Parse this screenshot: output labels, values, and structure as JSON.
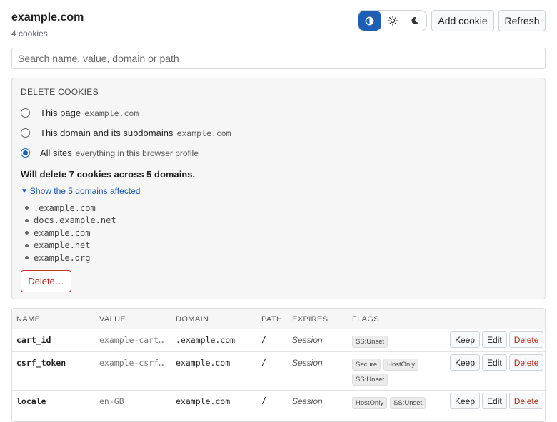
{
  "header": {
    "title": "example.com",
    "subtitle": "4 cookies",
    "theme_modes": [
      {
        "name": "auto-theme-icon",
        "active": true
      },
      {
        "name": "sun-icon",
        "active": false
      },
      {
        "name": "moon-icon",
        "active": false
      }
    ],
    "add_cookie_label": "Add cookie",
    "refresh_label": "Refresh"
  },
  "search": {
    "placeholder": "Search name, value, domain or path",
    "value": ""
  },
  "delete_panel": {
    "title": "DELETE COOKIES",
    "options": [
      {
        "label": "This page",
        "hint": "example.com",
        "checked": false
      },
      {
        "label": "This domain and its subdomains",
        "hint": "example.com",
        "checked": false
      },
      {
        "label": "All sites",
        "hint": "everything in this browser profile",
        "checked": true
      }
    ],
    "summary": "Will delete 7 cookies across 5 domains.",
    "toggle_label": "Show the 5 domains affected",
    "domains": [
      ".example.com",
      "docs.example.net",
      "example.com",
      "example.net",
      "example.org"
    ],
    "delete_label": "Delete…"
  },
  "table": {
    "columns": [
      "NAME",
      "VALUE",
      "DOMAIN",
      "PATH",
      "EXPIRES",
      "FLAGS"
    ],
    "rows": [
      {
        "name": "cart_id",
        "value": "example-cart…",
        "domain": ".example.com",
        "path": "/",
        "expires": "Session",
        "flags": [
          "SS:Unset"
        ]
      },
      {
        "name": "csrf_token",
        "value": "example-csrf…",
        "domain": "example.com",
        "path": "/",
        "expires": "Session",
        "flags": [
          "Secure",
          "HostOnly",
          "SS:Unset"
        ]
      },
      {
        "name": "locale",
        "value": "en-GB",
        "domain": "example.com",
        "path": "/",
        "expires": "Session",
        "flags": [
          "HostOnly",
          "SS:Unset"
        ]
      }
    ],
    "actions": {
      "keep": "Keep",
      "edit": "Edit",
      "delete": "Delete"
    }
  },
  "colors": {
    "accent": "#1e5fb4",
    "danger": "#b3261e",
    "panel_bg": "#f6f6f6"
  }
}
